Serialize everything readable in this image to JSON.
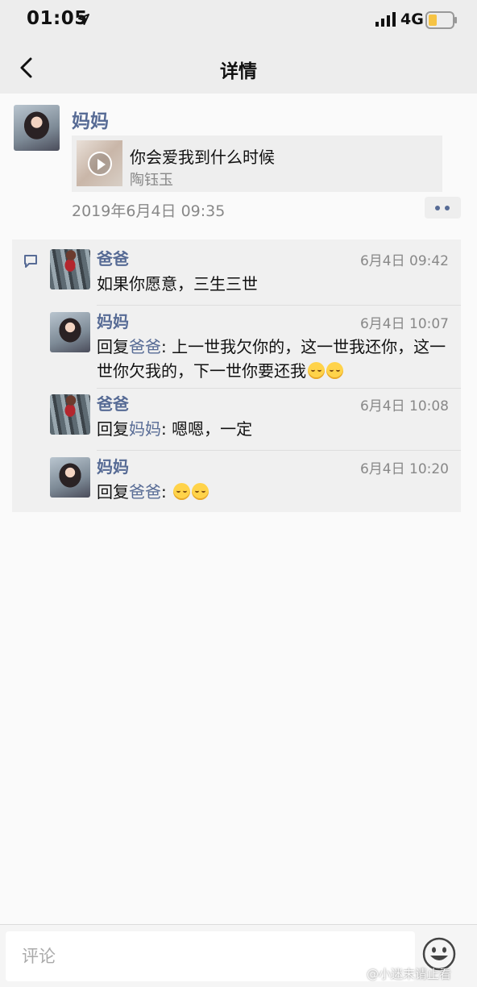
{
  "status_bar": {
    "time": "01:05",
    "network": "4G",
    "location_icon": "location-arrow-icon",
    "battery_color": "#f6c344"
  },
  "nav": {
    "title": "详情",
    "back_icon": "chevron-left-icon"
  },
  "post": {
    "author": "妈妈",
    "music": {
      "title": "你会爱我到什么时候",
      "artist": "陶钰玉"
    },
    "time": "2019年6月4日 09:35",
    "more_icon": "more-dots-icon"
  },
  "comments": [
    {
      "author": "爸爸",
      "time": "6月4日 09:42",
      "text": "如果你愿意，三生三世"
    },
    {
      "author": "妈妈",
      "time": "6月4日 10:07",
      "reply_prefix": "回复",
      "reply_to": "爸爸",
      "reply_sep": ": ",
      "text": "上一世我欠你的，这一世我还你，这一世你欠我的，下一世你要还我"
    },
    {
      "author": "爸爸",
      "time": "6月4日 10:08",
      "reply_prefix": "回复",
      "reply_to": "妈妈",
      "reply_sep": ": ",
      "text": "嗯嗯，一定"
    },
    {
      "author": "妈妈",
      "time": "6月4日 10:20",
      "reply_prefix": "回复",
      "reply_to": "爸爸",
      "reply_sep": ": ",
      "text": ""
    }
  ],
  "input": {
    "placeholder": "评论"
  },
  "watermark": "@小迷末请止看",
  "colors": {
    "link": "#576b95",
    "background": "#fafafa",
    "comment_bg": "#f0f0f0"
  }
}
